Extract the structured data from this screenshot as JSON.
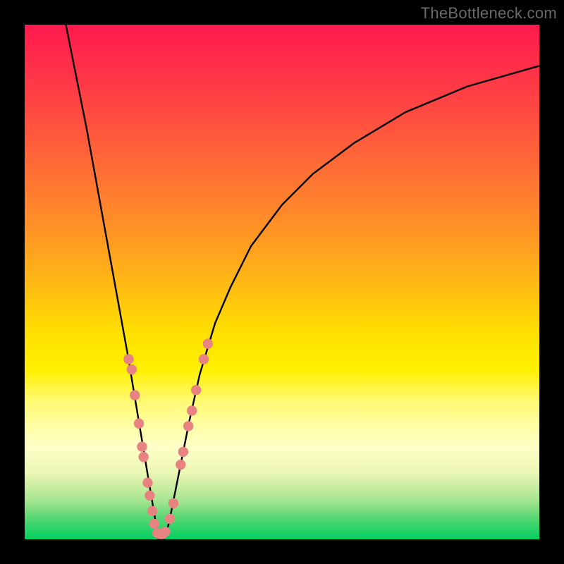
{
  "watermark": "TheBottleneck.com",
  "chart_data": {
    "type": "line",
    "title": "",
    "xlabel": "",
    "ylabel": "",
    "xlim": [
      0,
      100
    ],
    "ylim": [
      0,
      100
    ],
    "grid": false,
    "legend": false,
    "background": "rainbow-vertical",
    "series": [
      {
        "name": "bottleneck-curve",
        "color": "#000000",
        "x": [
          8,
          10,
          12,
          14,
          16,
          18,
          20,
          21,
          22,
          23,
          24,
          25,
          25.5,
          26,
          27,
          28,
          29,
          30,
          31,
          32,
          34,
          37,
          40,
          44,
          50,
          56,
          64,
          74,
          86,
          100
        ],
        "y": [
          100,
          90,
          80,
          69,
          58,
          47,
          36,
          30,
          24,
          18,
          12,
          6,
          3,
          0,
          0,
          3,
          8,
          13,
          18,
          23,
          32,
          42,
          49,
          57,
          65,
          71,
          77,
          83,
          88,
          92
        ]
      }
    ],
    "points": {
      "name": "measured-points",
      "color": "#e88381",
      "x": [
        20.2,
        20.8,
        21.4,
        22.2,
        22.8,
        23.1,
        23.9,
        24.3,
        24.8,
        25.2,
        25.8,
        26.3,
        26.8,
        27.3,
        28.2,
        28.9,
        30.3,
        30.8,
        31.8,
        32.5,
        33.3,
        34.8,
        35.6
      ],
      "y": [
        35.0,
        33.0,
        28.0,
        22.5,
        18.0,
        16.0,
        11.0,
        8.5,
        5.5,
        3.0,
        1.2,
        1.0,
        1.0,
        1.5,
        4.0,
        7.0,
        14.5,
        17.0,
        22.0,
        25.0,
        29.0,
        35.0,
        38.0
      ]
    }
  }
}
